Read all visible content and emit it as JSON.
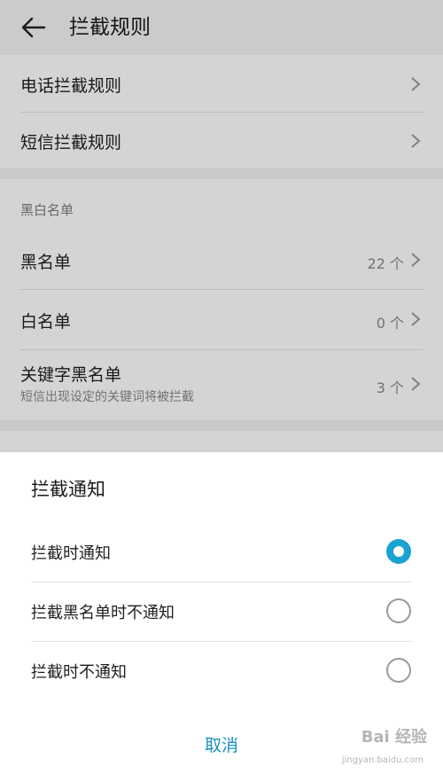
{
  "header": {
    "title": "拦截规则",
    "back_icon": "arrow-left-icon"
  },
  "rules": [
    {
      "label": "电话拦截规则"
    },
    {
      "label": "短信拦截规则"
    }
  ],
  "lists": {
    "section_title": "黑白名单",
    "items": [
      {
        "label": "黑名单",
        "value": "22 个"
      },
      {
        "label": "白名单",
        "value": "0 个"
      },
      {
        "label": "关键字黑名单",
        "sub": "短信出现设定的关键词将被拦截",
        "value": "3 个"
      }
    ]
  },
  "dialog": {
    "title": "拦截通知",
    "options": [
      {
        "label": "拦截时通知",
        "selected": true
      },
      {
        "label": "拦截黑名单时不通知",
        "selected": false
      },
      {
        "label": "拦截时不通知",
        "selected": false
      }
    ],
    "cancel_label": "取消",
    "accent_color": "#1aa3d1"
  },
  "watermark": {
    "text": "Bai 经验",
    "url": "jingyan.baidu.com"
  }
}
